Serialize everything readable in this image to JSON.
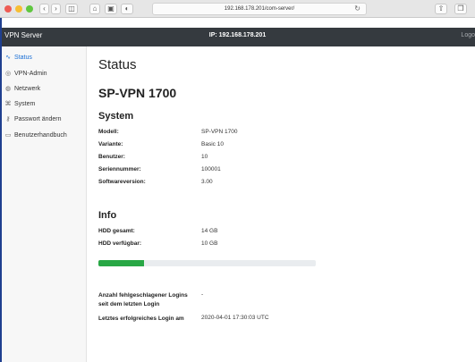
{
  "browser": {
    "url": "192.168.178.201/com-server/",
    "back_icon": "chevron-left-icon",
    "forward_icon": "chevron-right-icon"
  },
  "header": {
    "brand": "VPN Server",
    "ip_label": "IP: 192.168.178.201",
    "logout": "Logo"
  },
  "sidebar": {
    "items": [
      {
        "icon": "pulse-icon",
        "glyph": "∿",
        "label": "Status",
        "active": true
      },
      {
        "icon": "admin-icon",
        "glyph": "◎",
        "label": "VPN-Admin"
      },
      {
        "icon": "globe-icon",
        "glyph": "◍",
        "label": "Netzwerk"
      },
      {
        "icon": "system-icon",
        "glyph": "⌘",
        "label": "System"
      },
      {
        "icon": "key-icon",
        "glyph": "⚷",
        "label": "Passwort ändern"
      },
      {
        "icon": "book-icon",
        "glyph": "▭",
        "label": "Benutzerhandbuch"
      }
    ]
  },
  "main": {
    "page_title": "Status",
    "device_title": "SP-VPN 1700",
    "system": {
      "title": "System",
      "rows": [
        {
          "key": "Modell:",
          "value": "SP-VPN 1700"
        },
        {
          "key": "Variante:",
          "value": "Basic 10"
        },
        {
          "key": "Benutzer:",
          "value": "10"
        },
        {
          "key": "Seriennummer:",
          "value": "100001"
        },
        {
          "key": "Softwareversion:",
          "value": "3.00"
        }
      ]
    },
    "info": {
      "title": "Info",
      "rows": [
        {
          "key": "HDD gesamt:",
          "value": "14 GB"
        },
        {
          "key": "HDD verfügbar:",
          "value": "10 GB"
        }
      ],
      "progress_fraction": 0.21
    },
    "logins": {
      "failed_label_1": "Anzahl fehlgeschlagener Logins",
      "failed_label_2": "seit dem letzten Login",
      "failed_value": "-",
      "last_label": "Letztes erfolgreiches Login am",
      "last_value": "2020-04-01 17:30:03 UTC"
    }
  },
  "colors": {
    "header_bg": "#353a3f",
    "accent": "#1a6fd6",
    "progress": "#28a745"
  }
}
